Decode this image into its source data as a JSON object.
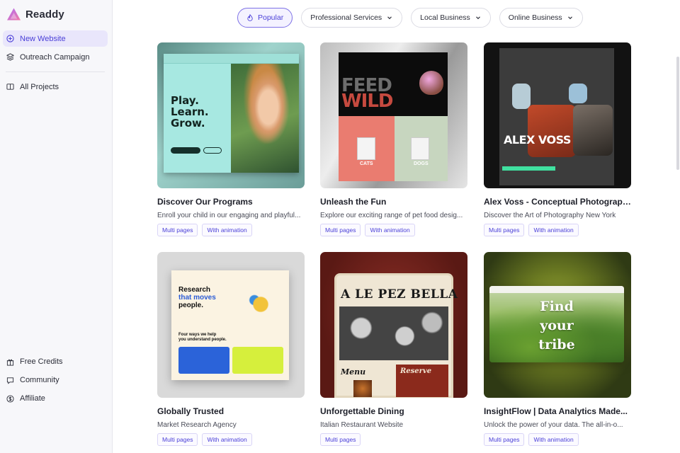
{
  "sidebar": {
    "logo_text": "Readdy",
    "top_items": [
      {
        "label": "New Website",
        "icon": "plus-circle-icon",
        "active": true
      },
      {
        "label": "Outreach Campaign",
        "icon": "layers-icon",
        "active": false
      }
    ],
    "projects_item": {
      "label": "All Projects",
      "icon": "book-icon"
    },
    "bottom_items": [
      {
        "label": "Free Credits",
        "icon": "gift-icon"
      },
      {
        "label": "Community",
        "icon": "message-icon"
      },
      {
        "label": "Affiliate",
        "icon": "dollar-circle-icon"
      }
    ]
  },
  "filters": [
    {
      "label": "Popular",
      "icon": "flame-icon",
      "active": true
    },
    {
      "label": "Professional Services",
      "icon": "chevron-down-icon",
      "active": false
    },
    {
      "label": "Local Business",
      "icon": "chevron-down-icon",
      "active": false
    },
    {
      "label": "Online Business",
      "icon": "chevron-down-icon",
      "active": false
    }
  ],
  "templates": [
    {
      "title": "Discover Our Programs",
      "description": "Enroll your child in our engaging and playful...",
      "tags": [
        "Multi pages",
        "With animation"
      ],
      "preview_text": [
        "Play.",
        "Learn.",
        "Grow."
      ]
    },
    {
      "title": "Unleash the Fun",
      "description": "Explore our exciting range of pet food desig...",
      "tags": [
        "Multi pages",
        "With animation"
      ],
      "preview_text": [
        "FEED",
        "WILD",
        "CATS",
        "DOGS"
      ]
    },
    {
      "title": "Alex Voss - Conceptual Photographer",
      "description": "Discover the Art of Photography New York",
      "tags": [
        "Multi pages",
        "With animation"
      ],
      "preview_text": [
        "ALEX VOSS"
      ]
    },
    {
      "title": "Globally Trusted",
      "description": "Market Research Agency",
      "tags": [
        "Multi pages",
        "With animation"
      ],
      "preview_text": [
        "Research",
        "that moves",
        "people.",
        "Four ways we help",
        "you understand people."
      ]
    },
    {
      "title": "Unforgettable Dining",
      "description": "Italian Restaurant Website",
      "tags": [
        "Multi pages"
      ],
      "preview_text": [
        "A LE PEZ BELLA",
        "Menu",
        "Reserve"
      ]
    },
    {
      "title": "InsightFlow | Data Analytics Made...",
      "description": "Unlock the power of your data. The all-in-o...",
      "tags": [
        "Multi pages",
        "With animation"
      ],
      "preview_text": [
        "Find",
        "your",
        "tribe"
      ]
    }
  ]
}
